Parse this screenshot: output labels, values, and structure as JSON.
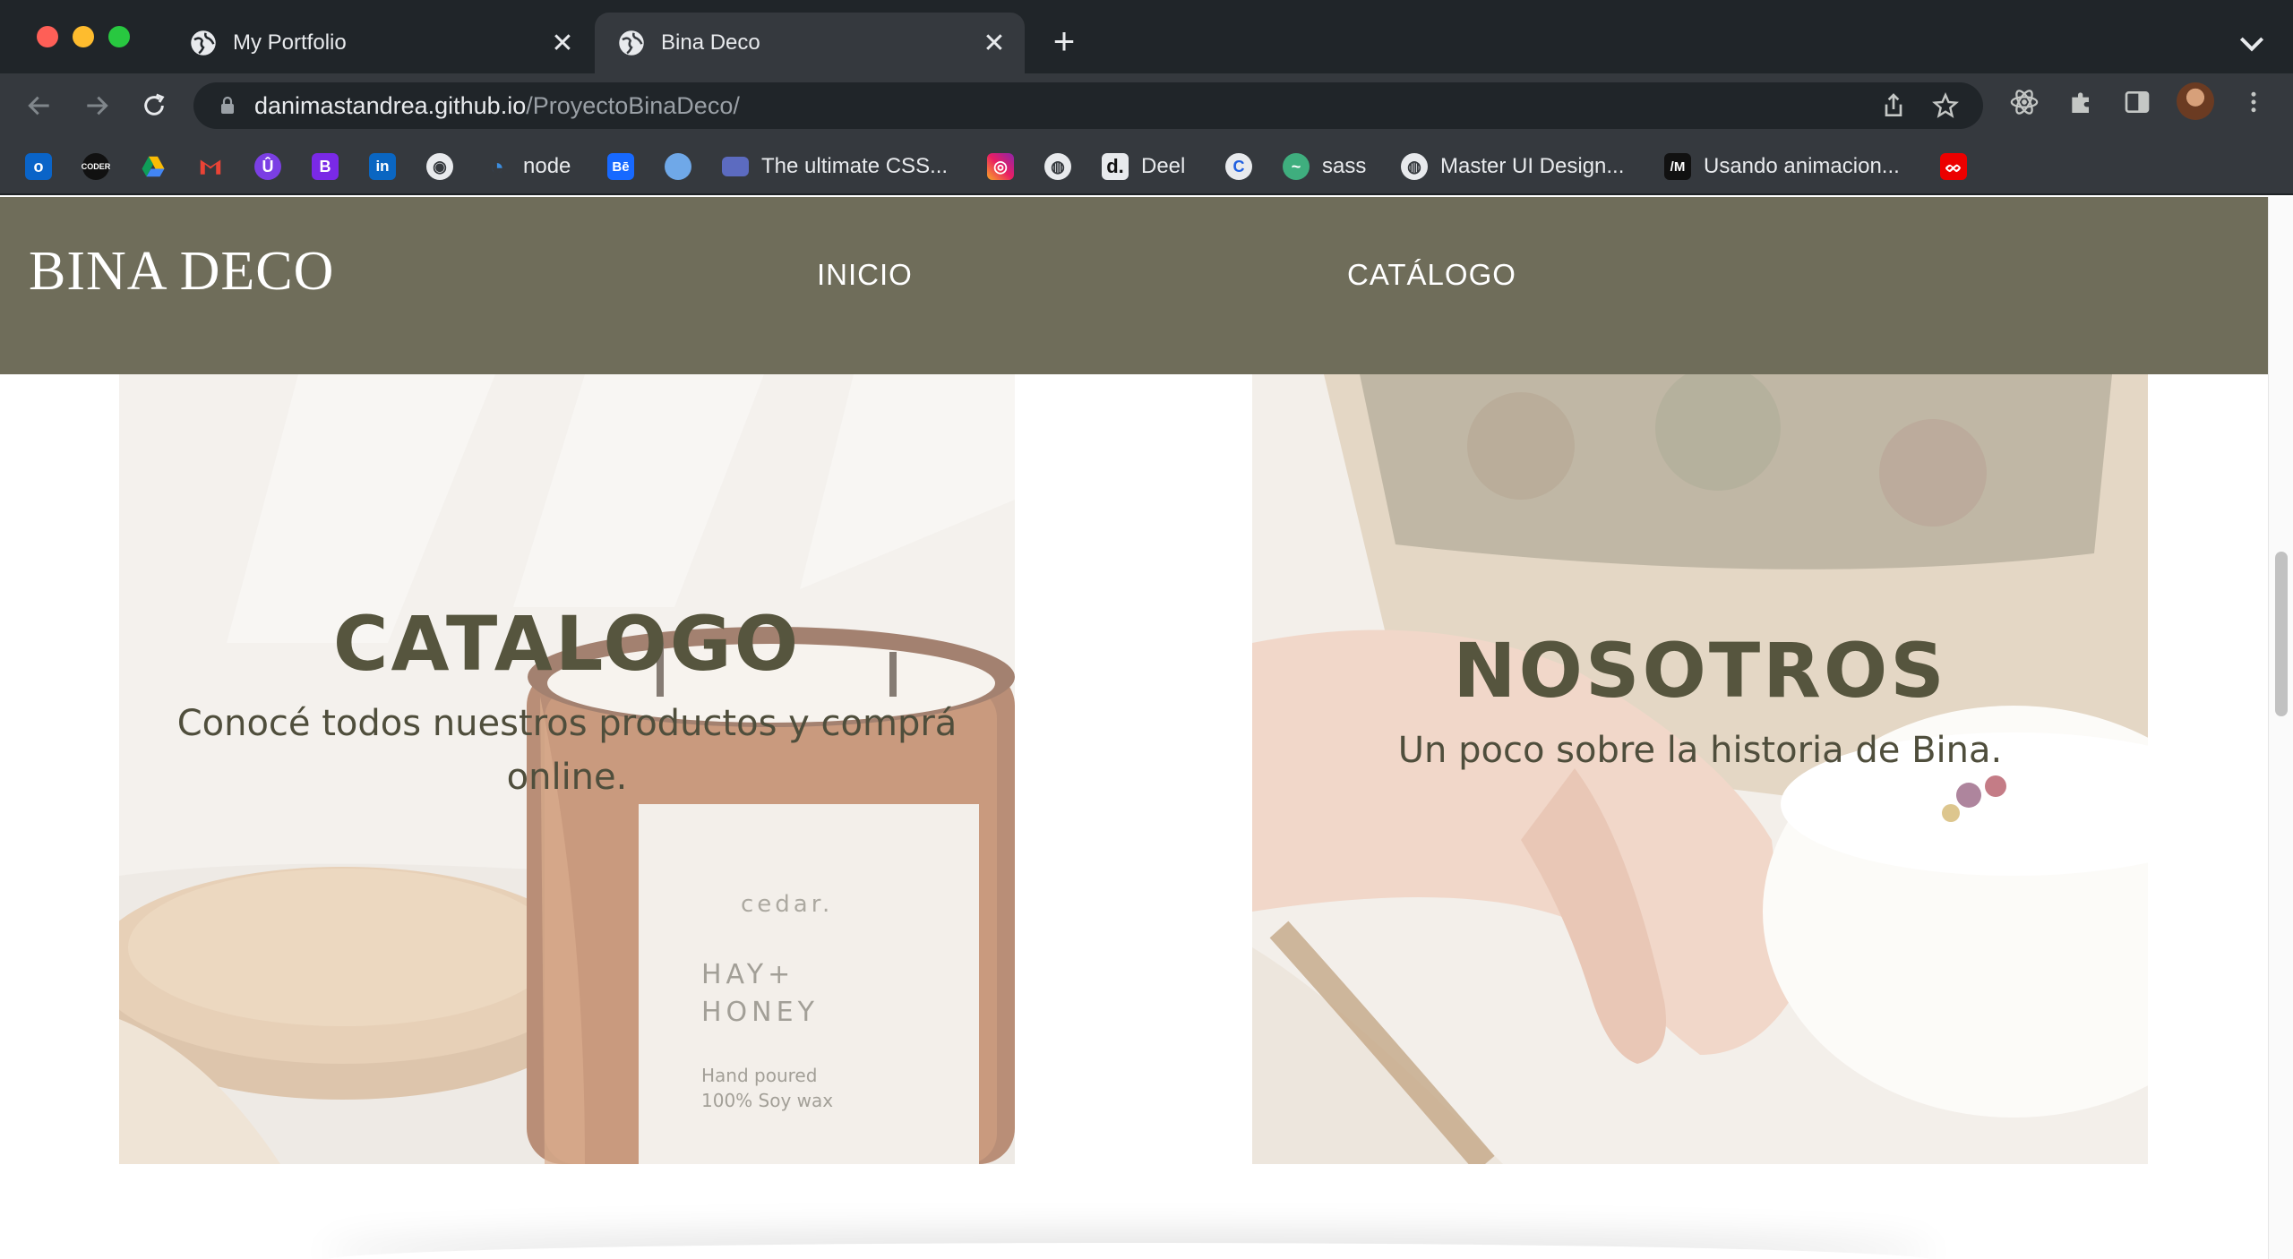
{
  "browser": {
    "tabs": [
      {
        "title": "My Portfolio",
        "active": false
      },
      {
        "title": "Bina Deco",
        "active": true
      }
    ],
    "url_host": "danimastandrea.github.io",
    "url_path": "/ProyectoBinaDeco/",
    "bookmarks": [
      {
        "icon": "outlook-icon",
        "label": ""
      },
      {
        "icon": "coder-icon",
        "label": ""
      },
      {
        "icon": "google-drive-icon",
        "label": ""
      },
      {
        "icon": "gmail-icon",
        "label": ""
      },
      {
        "icon": "u-icon",
        "label": ""
      },
      {
        "icon": "bootstrap-icon",
        "label": ""
      },
      {
        "icon": "linkedin-icon",
        "label": ""
      },
      {
        "icon": "github-icon",
        "label": ""
      },
      {
        "icon": "node-icon",
        "label": "node"
      },
      {
        "icon": "behance-icon",
        "label": ""
      },
      {
        "icon": "blob-icon",
        "label": ""
      },
      {
        "icon": "css-icon",
        "label": "The ultimate CSS..."
      },
      {
        "icon": "instagram-icon",
        "label": ""
      },
      {
        "icon": "globe-icon",
        "label": ""
      },
      {
        "icon": "deel-icon",
        "label": "Deel"
      },
      {
        "icon": "c-icon",
        "label": ""
      },
      {
        "icon": "sass-icon",
        "label": "sass"
      },
      {
        "icon": "globe-icon",
        "label": "Master UI Design..."
      },
      {
        "icon": "m-icon",
        "label": "Usando animacion..."
      },
      {
        "icon": "santander-icon",
        "label": ""
      }
    ]
  },
  "site": {
    "logo": "BINA DECO",
    "nav": {
      "inicio": "INICIO",
      "catalogo": "CATÁLOGO"
    }
  },
  "cards": {
    "catalogo": {
      "title": "CATALOGO",
      "text": "Conocé todos nuestros productos y comprá online."
    },
    "nosotros": {
      "title": "NOSOTROS",
      "text": "Un poco sobre la historia de Bina."
    }
  },
  "jar_label": {
    "brand": "cedar.",
    "line1": "HAY+",
    "line2": "HONEY",
    "line3": "Hand poured",
    "line4": "100% Soy wax"
  },
  "colors": {
    "header": "#6f6d5a",
    "card_title": "#56553e",
    "chrome_dark": "#202529",
    "chrome_toolbar": "#35393e"
  }
}
